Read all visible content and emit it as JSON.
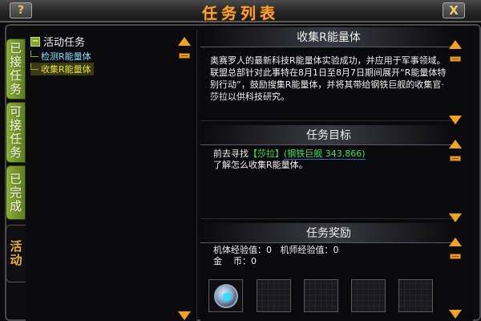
{
  "window": {
    "title": "任务列表",
    "help_label": "?",
    "close_label": "X"
  },
  "tabs": [
    {
      "label": "已接任务",
      "state": "inactive"
    },
    {
      "label": "可接任务",
      "state": "inactive"
    },
    {
      "label": "已完成",
      "state": "inactive"
    },
    {
      "label": "活动",
      "state": "active"
    }
  ],
  "task_tree": {
    "root_label": "活动任务",
    "root_toggle": "−",
    "items": [
      {
        "label": "检测R能量体",
        "selected": false
      },
      {
        "label": "收集R能量体",
        "selected": true
      }
    ]
  },
  "detail": {
    "title": "收集R能量体",
    "description": "奥赛罗人的最新科技R能量体实验成功，并应用于军事领域。联盟总部针对此事特在8月1日至8月7日期间展开“R能量体特别行动”，鼓励搜集R能量体，并将其带给钢铁巨舰的收集官·莎拉以供科技研究。",
    "target_header": "任务目标",
    "target_prefix": "前去寻找",
    "target_npc": "【莎拉】",
    "target_location": "(钢铁巨舰 343,866)",
    "target_line2": "了解怎么收集R能量体。",
    "reward_header": "任务奖励",
    "reward_line1": "机体经验值：0   机师经验值：0",
    "reward_line2": "金    币：0",
    "reward_item_icon": "satellite-orb-icon"
  },
  "colors": {
    "title": "#f3a43a",
    "tab_green": "#7fa52a",
    "arrow": "#f2a21c",
    "npc_link": "#40e060",
    "selected_item": "#e0e040",
    "tree_item": "#7fe0ff"
  }
}
